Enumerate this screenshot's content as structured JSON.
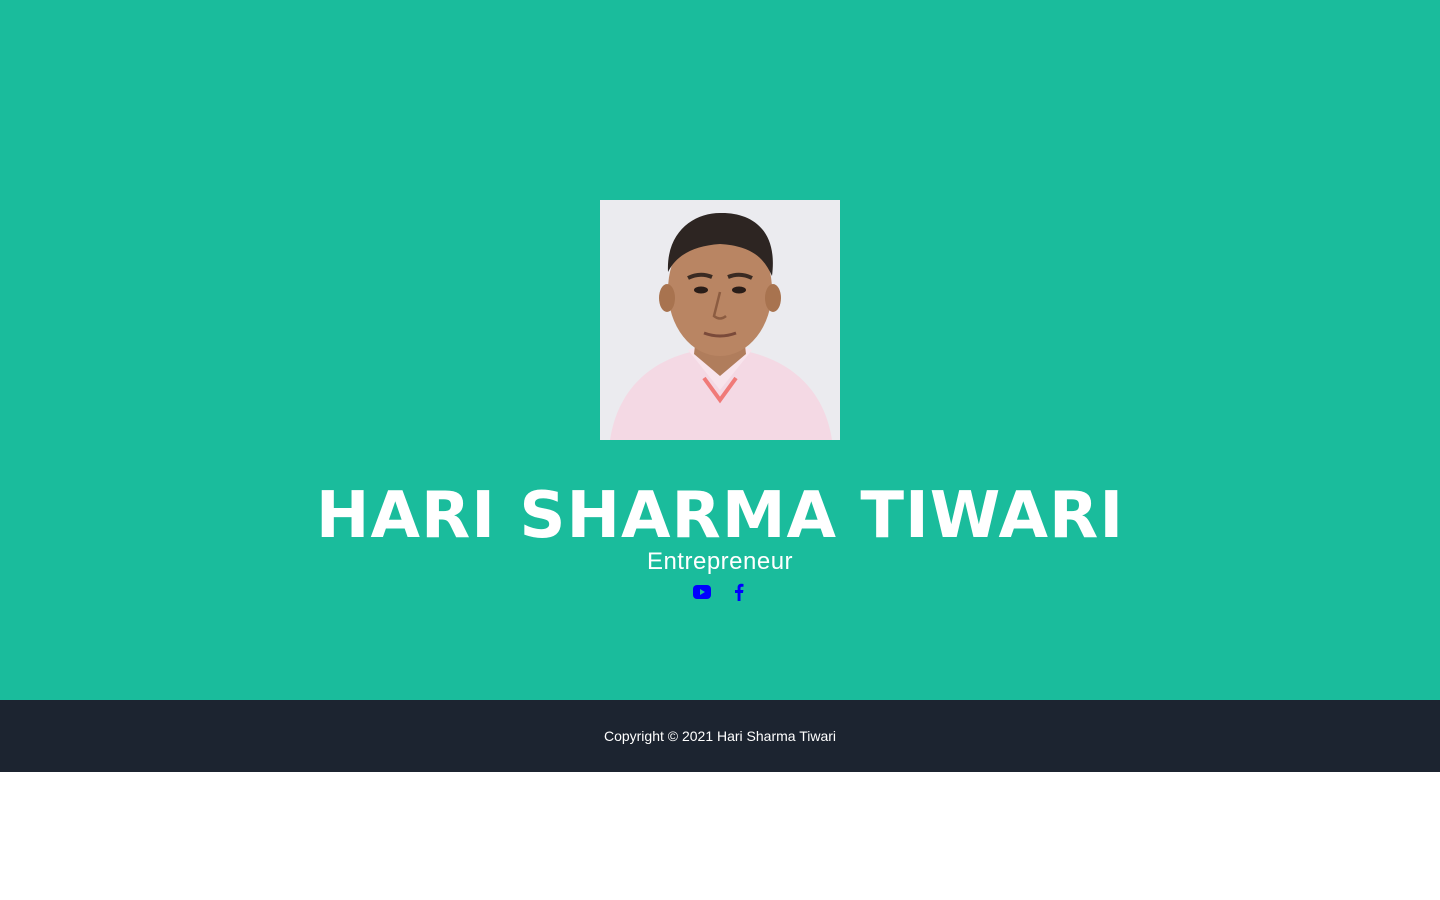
{
  "profile": {
    "name": "HARI SHARMA TIWARI",
    "role": "Entrepreneur",
    "photo_icon": "portrait-photo"
  },
  "socials": [
    {
      "icon": "youtube-icon",
      "color": "#0000ff"
    },
    {
      "icon": "facebook-icon",
      "color": "#0000ff"
    }
  ],
  "footer": {
    "copyright": "Copyright © 2021 Hari Sharma Tiwari"
  },
  "colors": {
    "hero_bg": "#1abc9c",
    "footer_bg": "#1c2430",
    "text": "#ffffff",
    "icon": "#0000ff"
  }
}
